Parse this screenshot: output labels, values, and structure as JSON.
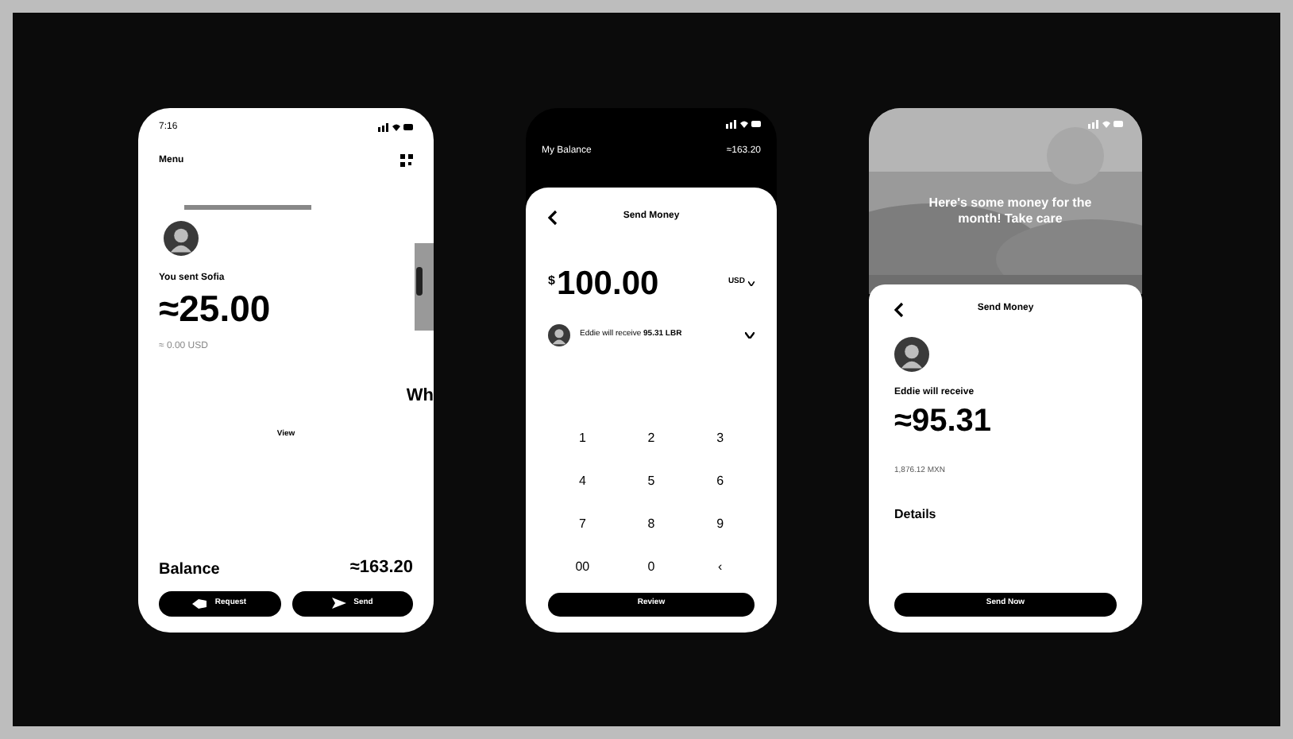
{
  "screens": [
    {
      "kind": "home",
      "time": "7:16",
      "menu": "Menu",
      "card": {
        "title": "You sent Sofia",
        "amount": "≈25.00",
        "sub": "≈ 0.00 USD"
      },
      "peek_title": "Wh",
      "view": "View",
      "balance": {
        "label": "Balance",
        "amount": "≈163.20"
      },
      "actions": [
        "Request",
        "Send"
      ]
    },
    {
      "kind": "send",
      "balance": {
        "label": "My Balance",
        "amount": "≈163.20"
      },
      "title": "Send Money",
      "currency_symbol": "$",
      "amount": "100.00",
      "currency": "USD",
      "note": "Eddie will receive **95.31 LBR**",
      "keys": [
        "1",
        "2",
        "3",
        "4",
        "5",
        "6",
        "7",
        "8",
        "9",
        "00",
        "0",
        "‹"
      ],
      "button": "Review"
    },
    {
      "kind": "confirm",
      "message": "Here's some money for the month! Take care",
      "title": "Send Money",
      "label": "Eddie will receive",
      "amount": "≈95.31",
      "rate": "1,876.12 MXN",
      "details": "Details",
      "button": "Send Now"
    }
  ]
}
